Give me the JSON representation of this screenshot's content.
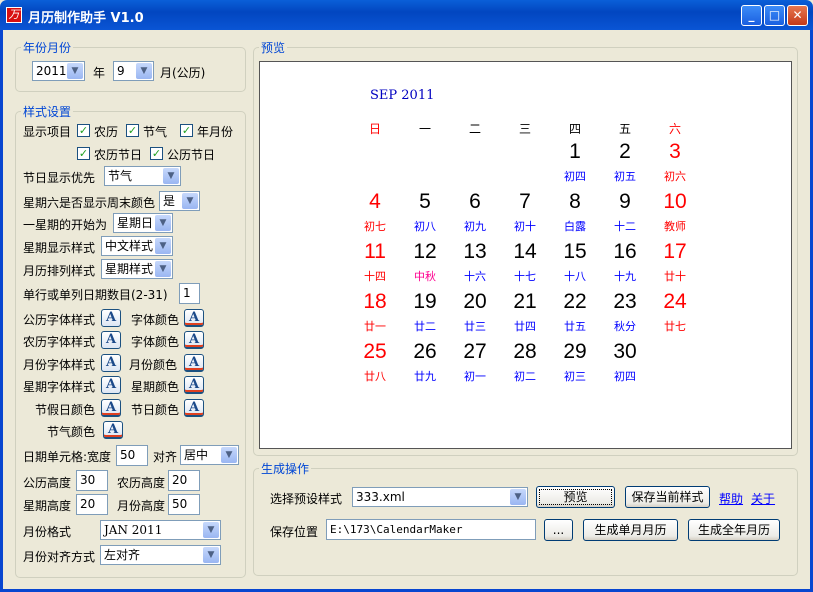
{
  "window": {
    "title": "月历制作助手  V1.0",
    "icon": "calendar-app-icon"
  },
  "year_month": {
    "label": "年份月份",
    "year": "2011",
    "year_suffix": "年",
    "month": "9",
    "month_suffix": "月(公历)"
  },
  "style": {
    "label": "样式设置",
    "show_items_label": "显示项目",
    "checkboxes": [
      {
        "label": "农历",
        "checked": true
      },
      {
        "label": "节气",
        "checked": true
      },
      {
        "label": "年月份",
        "checked": true
      },
      {
        "label": "农历节日",
        "checked": true
      },
      {
        "label": "公历节日",
        "checked": true
      }
    ],
    "holiday_priority_label": "节日显示优先",
    "holiday_priority": "节气",
    "saturday_weekend_label": "星期六是否显示周末颜色",
    "saturday_weekend": "是",
    "week_start_label": "一星期的开始为",
    "week_start": "星期日",
    "week_display_label": "星期显示样式",
    "week_display": "中文样式",
    "layout_label": "月历排列样式",
    "layout": "星期样式",
    "dates_per_row_label": "单行或单列日期数目(2-31)",
    "dates_per_row": "1",
    "font_rows": [
      {
        "left": "公历字体样式",
        "right": "字体颜色"
      },
      {
        "left": "农历字体样式",
        "right": "字体颜色"
      },
      {
        "left": "月份字体样式",
        "right": "月份颜色"
      },
      {
        "left": "星期字体样式",
        "right": "星期颜色"
      },
      {
        "left": "节假日颜色",
        "right": "节日颜色"
      },
      {
        "left": "节气颜色"
      }
    ],
    "font_button_glyph": "A",
    "cell_label": "日期单元格:宽度",
    "cell_width": "50",
    "align_label": "对齐",
    "align": "居中",
    "solar_height_label": "公历高度",
    "solar_height": "30",
    "lunar_height_label": "农历高度",
    "lunar_height": "20",
    "week_height_label": "星期高度",
    "week_height": "20",
    "month_height_label": "月份高度",
    "month_height": "50",
    "month_format_label": "月份格式",
    "month_format": "JAN 2011",
    "month_align_label": "月份对齐方式",
    "month_align": "左对齐"
  },
  "preview": {
    "label": "预览",
    "title": "SEP 2011",
    "weekdays": [
      "日",
      "一",
      "二",
      "三",
      "四",
      "五",
      "六"
    ],
    "colors": {
      "red": "#ff0000",
      "blue": "#0000ff",
      "black": "#000000",
      "magenta": "#ff0090"
    },
    "first_weekday": 4,
    "days": [
      {
        "d": "1",
        "l": "初四",
        "lc": "blue"
      },
      {
        "d": "2",
        "l": "初五",
        "lc": "blue"
      },
      {
        "d": "3",
        "l": "初六",
        "lc": "red"
      },
      {
        "d": "4",
        "l": "初七",
        "lc": "red"
      },
      {
        "d": "5",
        "l": "初八",
        "lc": "blue"
      },
      {
        "d": "6",
        "l": "初九",
        "lc": "blue"
      },
      {
        "d": "7",
        "l": "初十",
        "lc": "blue"
      },
      {
        "d": "8",
        "l": "白露",
        "lc": "blue"
      },
      {
        "d": "9",
        "l": "十二",
        "lc": "blue"
      },
      {
        "d": "10",
        "l": "教师",
        "lc": "red"
      },
      {
        "d": "11",
        "l": "十四",
        "lc": "red"
      },
      {
        "d": "12",
        "l": "中秋",
        "lc": "magenta"
      },
      {
        "d": "13",
        "l": "十六",
        "lc": "blue"
      },
      {
        "d": "14",
        "l": "十七",
        "lc": "blue"
      },
      {
        "d": "15",
        "l": "十八",
        "lc": "blue"
      },
      {
        "d": "16",
        "l": "十九",
        "lc": "blue"
      },
      {
        "d": "17",
        "l": "廿十",
        "lc": "red"
      },
      {
        "d": "18",
        "l": "廿一",
        "lc": "red"
      },
      {
        "d": "19",
        "l": "廿二",
        "lc": "blue"
      },
      {
        "d": "20",
        "l": "廿三",
        "lc": "blue"
      },
      {
        "d": "21",
        "l": "廿四",
        "lc": "blue"
      },
      {
        "d": "22",
        "l": "廿五",
        "lc": "blue"
      },
      {
        "d": "23",
        "l": "秋分",
        "lc": "blue"
      },
      {
        "d": "24",
        "l": "廿七",
        "lc": "red"
      },
      {
        "d": "25",
        "l": "廿八",
        "lc": "red"
      },
      {
        "d": "26",
        "l": "廿九",
        "lc": "blue"
      },
      {
        "d": "27",
        "l": "初一",
        "lc": "blue"
      },
      {
        "d": "28",
        "l": "初二",
        "lc": "blue"
      },
      {
        "d": "29",
        "l": "初三",
        "lc": "blue"
      },
      {
        "d": "30",
        "l": "初四",
        "lc": "blue"
      }
    ]
  },
  "generate": {
    "label": "生成操作",
    "preset_label": "选择预设样式",
    "preset": "333.xml",
    "preview_button": "预览",
    "save_style_button": "保存当前样式",
    "help_link": "帮助",
    "about_link": "关于",
    "save_path_label": "保存位置",
    "save_path": "E:\\173\\CalendarMaker",
    "browse_button": "...",
    "single_month_button": "生成单月月历",
    "full_year_button": "生成全年月历"
  }
}
